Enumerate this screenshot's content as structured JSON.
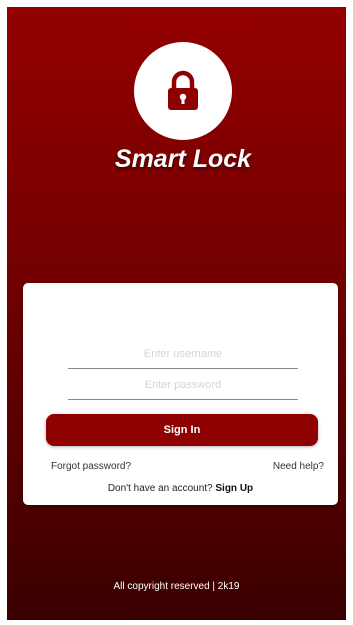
{
  "app": {
    "title": "Smart Lock",
    "logo_icon": "padlock-icon"
  },
  "login": {
    "username_placeholder": "Enter username",
    "password_placeholder": "Enter password",
    "sign_in_label": "Sign In",
    "forgot_password_label": "Forgot password?",
    "need_help_label": "Need help?",
    "no_account_text": "Don't have an account? ",
    "sign_up_label": "Sign Up"
  },
  "footer": {
    "copyright": "All copyright reserved | 2k19"
  },
  "colors": {
    "primary": "#8f0000",
    "gradient_top": "#930000",
    "gradient_bottom": "#3a0000"
  }
}
